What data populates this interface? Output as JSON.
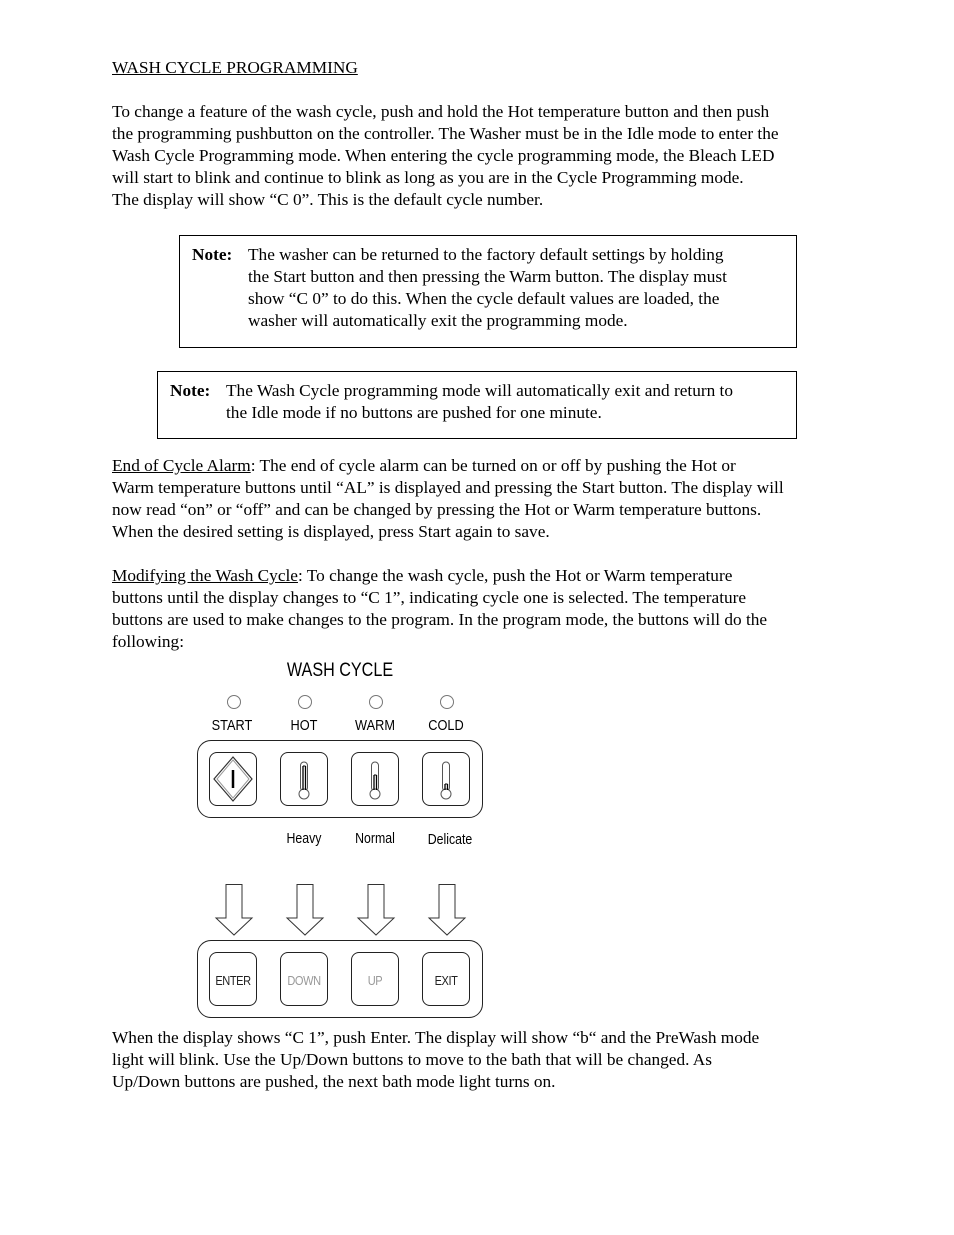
{
  "heading": "WASH CYCLE PROGRAMMING",
  "intro": "To change a feature of the wash cycle, push and hold the Hot temperature button and then push\nthe programming pushbutton on the controller.  The Washer must be in the Idle mode to enter the\nWash Cycle Programming mode.  When entering the cycle programming mode, the Bleach LED\nwill start to blink and continue to blink as long as you are in the Cycle Programming mode.\nThe display will show “C  0”.  This is the default cycle number.",
  "notes": [
    {
      "label": "Note:",
      "text": "The washer can be returned to the factory default settings by holding\nthe Start button and then pressing the Warm button.  The display must\nshow “C  0” to do this.  When the cycle default values are loaded, the\nwasher will automatically exit the programming mode."
    },
    {
      "label": "Note:",
      "text": "The Wash Cycle programming mode will automatically exit and return to\nthe Idle mode if no buttons are pushed for one minute."
    }
  ],
  "alarm": {
    "title": "End of Cycle Alarm",
    "text": ":  The end of cycle alarm can be turned on or off by pushing the Hot or\nWarm temperature buttons until “AL” is displayed and pressing the Start button. The display will\nnow read “on” or “off” and can be changed by pressing the Hot or Warm temperature buttons.\nWhen the desired setting is displayed, press Start again to save."
  },
  "modify": {
    "title": "Modifying the Wash Cycle",
    "text": ": To change the wash cycle, push the Hot or Warm temperature\nbuttons until the display changes to “C  1”, indicating cycle one is selected.  The temperature\nbuttons are used to make changes to the program.  In the program mode, the buttons will do the\nfollowing:"
  },
  "diagram": {
    "title": "WASH  CYCLE",
    "top_buttons": [
      {
        "label": "START",
        "icon": "start-diamond-icon",
        "sub": ""
      },
      {
        "label": "HOT",
        "icon": "thermometer-high-icon",
        "sub": "Heavy"
      },
      {
        "label": "WARM",
        "icon": "thermometer-medium-icon",
        "sub": "Normal"
      },
      {
        "label": "COLD",
        "icon": "thermometer-low-icon",
        "sub": "Delicate"
      }
    ],
    "bottom_buttons": [
      "ENTER",
      "DOWN",
      "UP",
      "EXIT"
    ]
  },
  "closing": "When the display shows “C  1”, push Enter.  The display will show “b“ and the PreWash mode\nlight will blink.  Use the Up/Down buttons to move to the bath that will be changed.  As\nUp/Down buttons are pushed, the next bath mode light turns on."
}
